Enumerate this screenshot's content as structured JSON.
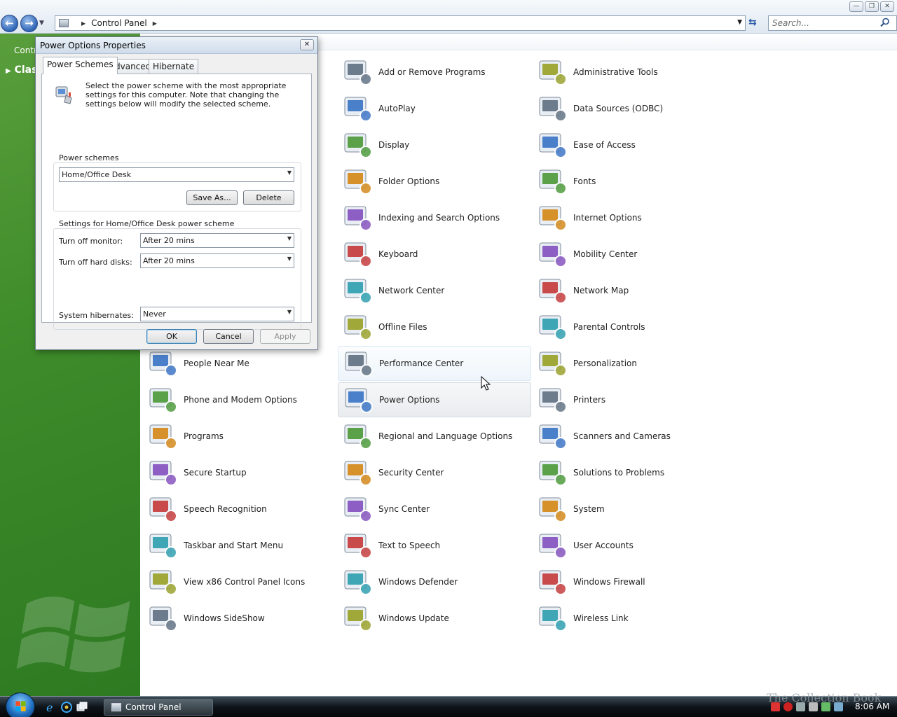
{
  "window": {
    "caption_buttons": [
      "—",
      "❐",
      "✕"
    ],
    "address_segments": [
      "Control Panel"
    ],
    "search_placeholder": "Search..."
  },
  "task_pane": {
    "hint_partial": "Contr",
    "classic_view_partial": "Clas"
  },
  "grid": {
    "columns": [
      [
        {
          "label": "People Near Me",
          "icon": "people-near-me-icon"
        },
        {
          "label": "Phone and Modem Options",
          "icon": "phone-modem-icon"
        },
        {
          "label": "Programs",
          "icon": "programs-icon"
        },
        {
          "label": "Secure Startup",
          "icon": "keys-icon"
        },
        {
          "label": "Speech Recognition",
          "icon": "microphone-icon"
        },
        {
          "label": "Taskbar and Start Menu",
          "icon": "taskbar-icon"
        },
        {
          "label": "View x86 Control Panel Icons",
          "icon": "view-x86-icon"
        },
        {
          "label": "Windows SideShow",
          "icon": "sideshow-icon"
        }
      ],
      [
        {
          "label": "Add or Remove Programs",
          "icon": "add-remove-programs-icon"
        },
        {
          "label": "AutoPlay",
          "icon": "autoplay-icon"
        },
        {
          "label": "Display",
          "icon": "display-icon"
        },
        {
          "label": "Folder Options",
          "icon": "folder-options-icon"
        },
        {
          "label": "Indexing and Search Options",
          "icon": "indexing-icon"
        },
        {
          "label": "Keyboard",
          "icon": "keyboard-icon"
        },
        {
          "label": "Network Center",
          "icon": "network-center-icon"
        },
        {
          "label": "Offline Files",
          "icon": "offline-files-icon"
        },
        {
          "label": "Performance Center",
          "icon": "performance-icon"
        },
        {
          "label": "Power Options",
          "icon": "power-options-icon"
        },
        {
          "label": "Regional and Language Options",
          "icon": "globe-icon"
        },
        {
          "label": "Security Center",
          "icon": "shield-icon"
        },
        {
          "label": "Sync Center",
          "icon": "sync-icon"
        },
        {
          "label": "Text to Speech",
          "icon": "text-to-speech-icon"
        },
        {
          "label": "Windows Defender",
          "icon": "defender-icon"
        },
        {
          "label": "Windows Update",
          "icon": "windows-update-icon"
        }
      ],
      [
        {
          "label": "Administrative Tools",
          "icon": "admin-tools-icon"
        },
        {
          "label": "Data Sources (ODBC)",
          "icon": "data-sources-icon"
        },
        {
          "label": "Ease of Access",
          "icon": "ease-of-access-icon"
        },
        {
          "label": "Fonts",
          "icon": "fonts-folder-icon"
        },
        {
          "label": "Internet Options",
          "icon": "internet-options-icon"
        },
        {
          "label": "Mobility Center",
          "icon": "mobility-center-icon"
        },
        {
          "label": "Network Map",
          "icon": "network-map-icon"
        },
        {
          "label": "Parental Controls",
          "icon": "parental-controls-icon"
        },
        {
          "label": "Personalization",
          "icon": "personalization-icon"
        },
        {
          "label": "Printers",
          "icon": "printer-icon"
        },
        {
          "label": "Scanners and Cameras",
          "icon": "scanner-icon"
        },
        {
          "label": "Solutions to Problems",
          "icon": "solutions-icon"
        },
        {
          "label": "System",
          "icon": "system-icon"
        },
        {
          "label": "User Accounts",
          "icon": "user-accounts-icon"
        },
        {
          "label": "Windows Firewall",
          "icon": "firewall-icon"
        },
        {
          "label": "Wireless Link",
          "icon": "wireless-link-icon"
        }
      ]
    ],
    "hovered_item": "Performance Center",
    "selected_item": "Power Options"
  },
  "dialog": {
    "title": "Power Options Properties",
    "close_glyph": "✕",
    "tabs": [
      "Power Schemes",
      "Advanced",
      "Hibernate"
    ],
    "active_tab": "Power Schemes",
    "intro": "Select the power scheme with the most appropriate settings for this computer. Note that changing the settings below will modify the selected scheme.",
    "schemes_group_label": "Power schemes",
    "scheme_value": "Home/Office Desk",
    "save_as_label": "Save As...",
    "delete_label": "Delete",
    "settings_group_label": "Settings for Home/Office Desk power scheme",
    "monitor_label": "Turn off monitor:",
    "monitor_value": "After 20 mins",
    "disks_label": "Turn off hard disks:",
    "disks_value": "After 20 mins",
    "hibernate_label": "System hibernates:",
    "hibernate_value": "Never",
    "ok_label": "OK",
    "cancel_label": "Cancel",
    "apply_label": "Apply"
  },
  "taskbar": {
    "task_button_label": "Control Panel",
    "watermark": "The Collection Book",
    "clock": "8:06 AM"
  },
  "colors": {
    "task_pane_green": "#3d8b2a",
    "selection_blue": "#3c7fb1"
  }
}
